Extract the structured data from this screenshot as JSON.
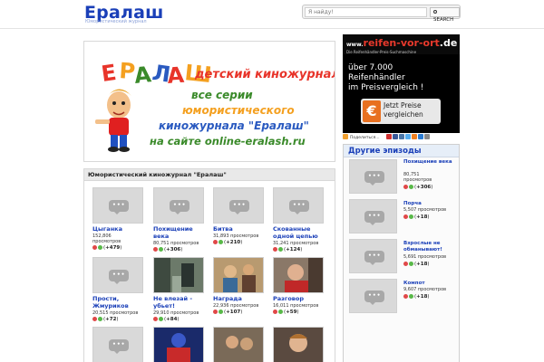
{
  "header": {
    "logo": "Ералаш",
    "tagline": "Юмористический журнал",
    "search_placeholder": "Я найду!",
    "search_button": "SEARCH"
  },
  "banner": {
    "logo_text": "ЕРАЛАШ",
    "lines": [
      "детский киножурнал",
      "все серии",
      "юмористического",
      "киножурнала \"Ералаш\"",
      "на сайте online-eralash.ru"
    ]
  },
  "section": {
    "title": "Юмористический киножурнал \"Ералаш\"",
    "items": [
      {
        "title": "Цыганка",
        "views": "152,806",
        "views_label": "просмотров",
        "rating": "+479"
      },
      {
        "title": "Похищение века",
        "views": "80,751",
        "views_label": "просмотров",
        "rating": "+306"
      },
      {
        "title": "Битва",
        "views": "31,893",
        "views_label": "просмотров",
        "rating": "+210"
      },
      {
        "title": "Скованные одной цепью",
        "views": "31,241",
        "views_label": "просмотров",
        "rating": "+124"
      },
      {
        "title": "Прости, Жмуриков",
        "views": "20,515",
        "views_label": "просмотров",
        "rating": "+72"
      },
      {
        "title": "Не влезай - убьет!",
        "views": "29,910",
        "views_label": "просмотров",
        "rating": "+84"
      },
      {
        "title": "Награда",
        "views": "22,936",
        "views_label": "просмотров",
        "rating": "+107"
      },
      {
        "title": "Разговор",
        "views": "16,011",
        "views_label": "просмотров",
        "rating": "+59"
      }
    ]
  },
  "ad": {
    "brand_pre": "www.",
    "brand_main": "reifen-vor-ort",
    "brand_suffix": ".de",
    "sub": "Die Reifenhändler-Preis-Suchmaschine",
    "line1": "über 7.000",
    "line2": "Reifenhändler",
    "line3": "im Preisvergleich !",
    "button_line1": "Jetzt Preise",
    "button_line2": "vergleichen",
    "euro": "€"
  },
  "share": {
    "label": "Поделиться..."
  },
  "sidebar": {
    "title": "Другие эпизоды",
    "items": [
      {
        "title": "Похищение века",
        "views": "80,751",
        "views_label": "просмотров",
        "rating": "+306"
      },
      {
        "title": "Порча",
        "views": "5,507 просмотров",
        "views_label": "",
        "rating": "+18"
      },
      {
        "title": "Взрослые не обманывают!",
        "views": "5,691 просмотров",
        "views_label": "",
        "rating": "+18"
      },
      {
        "title": "Компот",
        "views": "9,607 просмотров",
        "views_label": "",
        "rating": "+18"
      }
    ]
  },
  "colors": {
    "link": "#1a3fb8",
    "rating_up": "#58b848",
    "rating_down": "#e04848",
    "ad_accent": "#e87020"
  }
}
